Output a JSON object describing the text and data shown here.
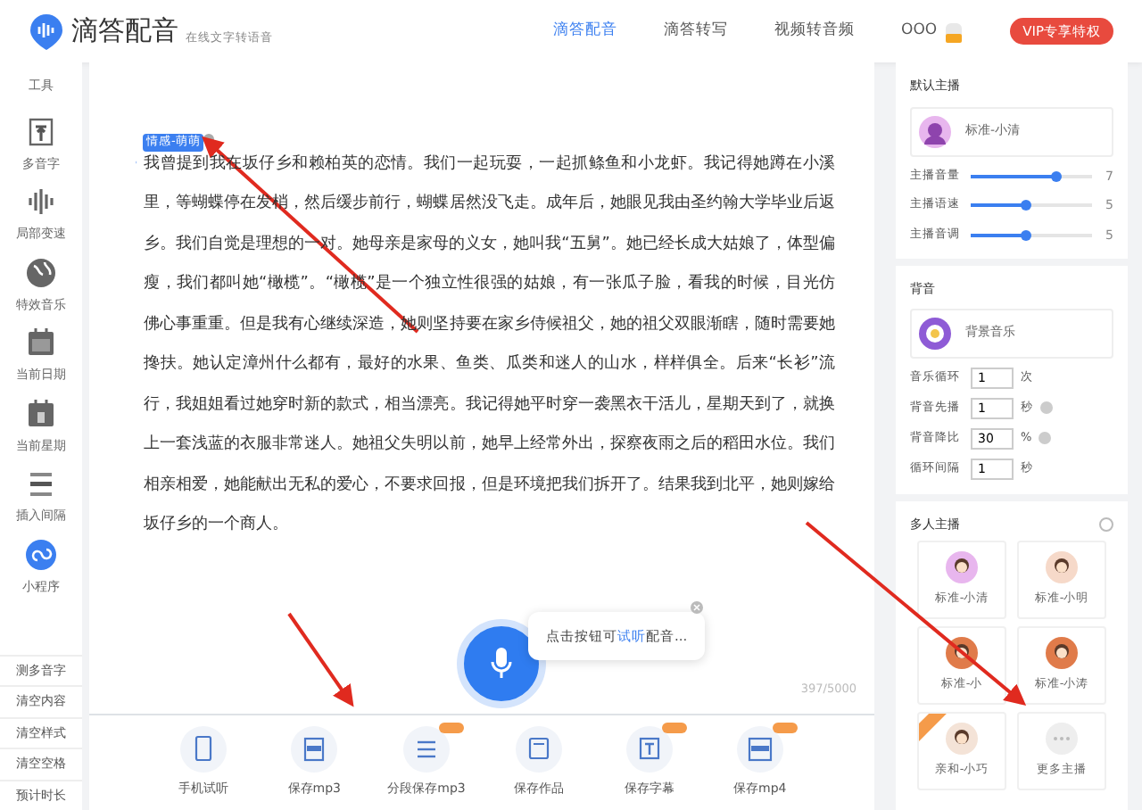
{
  "header": {
    "logo": {
      "title": "滴答配音",
      "subtitle": "在线文字转语音"
    },
    "nav": [
      {
        "label": "滴答配音",
        "selected": true
      },
      {
        "label": "滴答转写",
        "selected": false
      },
      {
        "label": "视频转音频",
        "selected": false
      }
    ],
    "user": {
      "name": "OOO"
    },
    "vip_button": "VIP专享特权"
  },
  "sidebar": {
    "heading": "工具",
    "tools": [
      {
        "label": "多音字"
      },
      {
        "label": "局部变速"
      },
      {
        "label": "特效音乐"
      },
      {
        "label": "当前日期"
      },
      {
        "label": "当前星期"
      },
      {
        "label": "插入间隔"
      },
      {
        "label": "小程序"
      }
    ],
    "actions": [
      {
        "label": "测多音字"
      },
      {
        "label": "清空内容"
      },
      {
        "label": "清空样式"
      },
      {
        "label": "清空空格"
      },
      {
        "label": "预计时长"
      }
    ]
  },
  "editor": {
    "voice_tag": "情感-萌萌",
    "text": "我曾提到我在坂仔乡和赖柏英的恋情。我们一起玩耍，一起抓鲦鱼和小龙虾。我记得她蹲在小溪里，等蝴蝶停在发梢，然后缓步前行，蝴蝶居然没飞走。成年后，她眼见我由圣约翰大学毕业后返乡。我们自觉是理想的一对。她母亲是家母的义女，她叫我“五舅”。她已经长成大姑娘了，体型偏瘦，我们都叫她“橄榄”。“橄榄”是一个独立性很强的姑娘，有一张瓜子脸，看我的时候，目光仿佛心事重重。但是我有心继续深造，她则坚持要在家乡侍候祖父，她的祖父双眼渐瞎，随时需要她搀扶。她认定漳州什么都有，最好的水果、鱼类、瓜类和迷人的山水，样样俱全。后来“长衫”流行，我姐姐看过她穿时新的款式，相当漂亮。我记得她平时穿一袭黑衣干活儿，星期天到了，就换上一套浅蓝的衣服非常迷人。她祖父失明以前，她早上经常外出，探察夜雨之后的稻田水位。我们相亲相爱，她能献出无私的爱心，不要求回报，但是环境把我们拆开了。结果我到北平，她则嫁给坂仔乡的一个商人。",
    "tooltip": {
      "before": "点击按钮可",
      "link": "试听",
      "after": "配音..."
    },
    "counter": "397/5000"
  },
  "toolbar": [
    {
      "label": "手机试听",
      "vip": false
    },
    {
      "label": "保存mp3",
      "vip": false
    },
    {
      "label": "分段保存mp3",
      "vip": true
    },
    {
      "label": "保存作品",
      "vip": false
    },
    {
      "label": "保存字幕",
      "vip": true
    },
    {
      "label": "保存mp4",
      "vip": true
    }
  ],
  "default_host": {
    "heading": "默认主播",
    "voice": "标准-小清",
    "sliders": [
      {
        "label": "主播音量",
        "level": 0.7,
        "reading": "7"
      },
      {
        "label": "主播语速",
        "level": 0.45,
        "reading": "5"
      },
      {
        "label": "主播音调",
        "level": 0.45,
        "reading": "5"
      }
    ]
  },
  "background": {
    "heading": "背音",
    "music": "背景音乐",
    "settings": [
      {
        "label": "音乐循环",
        "value": "1",
        "unit": "次",
        "help": false
      },
      {
        "label": "背音先播",
        "value": "1",
        "unit": "秒",
        "help": true
      },
      {
        "label": "背音降比",
        "value": "30",
        "unit": "%",
        "help": true
      },
      {
        "label": "循环间隔",
        "value": "1",
        "unit": "秒",
        "help": false
      }
    ]
  },
  "multi_host": {
    "heading": "多人主播",
    "voices": [
      {
        "kind": "voice",
        "label": "标准-小清",
        "vip": false
      },
      {
        "kind": "voice",
        "label": "标准-小明",
        "vip": false
      },
      {
        "kind": "voice",
        "label": "标准-小",
        "vip": false
      },
      {
        "kind": "voice",
        "label": "标准-小涛",
        "vip": false
      },
      {
        "kind": "voice",
        "label": "亲和-小巧",
        "vip": true
      },
      {
        "kind": "more",
        "label": "更多主播",
        "vip": false
      }
    ]
  }
}
